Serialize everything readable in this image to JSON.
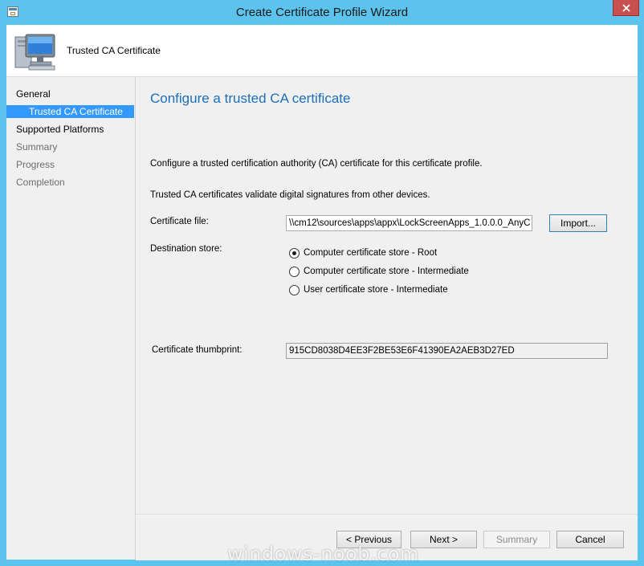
{
  "window": {
    "title": "Create Certificate Profile Wizard",
    "accent_color": "#5bc3ec",
    "close_color": "#c7504f"
  },
  "header": {
    "title": "Trusted CA Certificate",
    "icon": "computer-icon"
  },
  "sidebar": {
    "items": [
      {
        "label": "General",
        "state": "done"
      },
      {
        "label": "Trusted CA Certificate",
        "state": "active"
      },
      {
        "label": "Supported Platforms",
        "state": "done"
      },
      {
        "label": "Summary",
        "state": "pending"
      },
      {
        "label": "Progress",
        "state": "pending"
      },
      {
        "label": "Completion",
        "state": "pending"
      }
    ]
  },
  "main": {
    "heading": "Configure a trusted CA certificate",
    "intro": "Configure a trusted certification authority (CA) certificate for this certificate profile.",
    "description": "Trusted CA certificates validate digital signatures from other devices.",
    "certificate_file": {
      "label": "Certificate file:",
      "value": "\\\\cm12\\sources\\apps\\appx\\LockScreenApps_1.0.0.0_AnyC",
      "import_label": "Import..."
    },
    "destination_store": {
      "label": "Destination store:",
      "options": [
        {
          "label": "Computer certificate store - Root",
          "checked": true
        },
        {
          "label": "Computer certificate store - Intermediate",
          "checked": false
        },
        {
          "label": "User certificate store - Intermediate",
          "checked": false
        }
      ]
    },
    "thumbprint": {
      "label": "Certificate thumbprint:",
      "value": "915CD8038D4EE3F2BE53E6F41390EA2AEB3D27ED"
    }
  },
  "footer": {
    "previous": "< Previous",
    "next": "Next >",
    "summary": "Summary",
    "cancel": "Cancel"
  },
  "watermark": "windows-noob.com"
}
